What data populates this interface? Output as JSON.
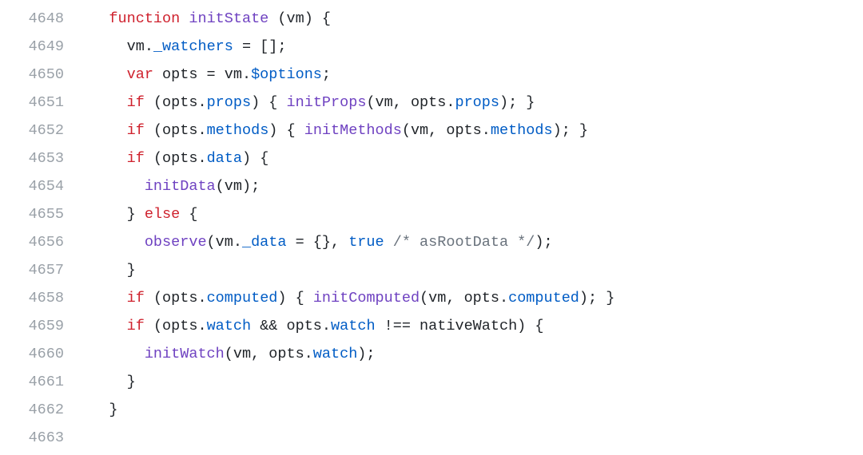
{
  "domain": "Computer-Use",
  "editor": {
    "language": "javascript",
    "first_line_number": 4648,
    "line_numbers": [
      "4648",
      "4649",
      "4650",
      "4651",
      "4652",
      "4653",
      "4654",
      "4655",
      "4656",
      "4657",
      "4658",
      "4659",
      "4660",
      "4661",
      "4662",
      "4663"
    ],
    "colors": {
      "keyword": "#cf222e",
      "function": "#6f42c1",
      "property": "#005cc5",
      "comment": "#6a737d",
      "gutter": "#9aa1a8",
      "text": "#1f2328",
      "background": "#ffffff"
    },
    "plain_source": "    function initState (vm) {\n      vm._watchers = [];\n      var opts = vm.$options;\n      if (opts.props) { initProps(vm, opts.props); }\n      if (opts.methods) { initMethods(vm, opts.methods); }\n      if (opts.data) {\n        initData(vm);\n      } else {\n        observe(vm._data = {}, true /* asRootData */);\n      }\n      if (opts.computed) { initComputed(vm, opts.computed); }\n      if (opts.watch && opts.watch !== nativeWatch) {\n        initWatch(vm, opts.watch);\n      }\n    }\n",
    "lines": [
      {
        "indent": "    ",
        "tokens": [
          {
            "t": "function",
            "c": "tk-kw"
          },
          {
            "t": " "
          },
          {
            "t": "initState",
            "c": "tk-fn"
          },
          {
            "t": " ("
          },
          {
            "t": "vm",
            "c": "tk-param"
          },
          {
            "t": ") {"
          }
        ]
      },
      {
        "indent": "      ",
        "tokens": [
          {
            "t": "vm"
          },
          {
            "t": ".",
            "c": "tk-punc"
          },
          {
            "t": "_watchers",
            "c": "tk-prop"
          },
          {
            "t": " = [];"
          }
        ]
      },
      {
        "indent": "      ",
        "tokens": [
          {
            "t": "var",
            "c": "tk-kw"
          },
          {
            "t": " opts = vm"
          },
          {
            "t": ".",
            "c": "tk-punc"
          },
          {
            "t": "$options",
            "c": "tk-prop"
          },
          {
            "t": ";"
          }
        ]
      },
      {
        "indent": "      ",
        "tokens": [
          {
            "t": "if",
            "c": "tk-kw"
          },
          {
            "t": " (opts"
          },
          {
            "t": ".",
            "c": "tk-punc"
          },
          {
            "t": "props",
            "c": "tk-prop"
          },
          {
            "t": ") { "
          },
          {
            "t": "initProps",
            "c": "tk-fn"
          },
          {
            "t": "(vm, opts"
          },
          {
            "t": ".",
            "c": "tk-punc"
          },
          {
            "t": "props",
            "c": "tk-prop"
          },
          {
            "t": "); }"
          }
        ]
      },
      {
        "indent": "      ",
        "tokens": [
          {
            "t": "if",
            "c": "tk-kw"
          },
          {
            "t": " (opts"
          },
          {
            "t": ".",
            "c": "tk-punc"
          },
          {
            "t": "methods",
            "c": "tk-prop"
          },
          {
            "t": ") { "
          },
          {
            "t": "initMethods",
            "c": "tk-fn"
          },
          {
            "t": "(vm, opts"
          },
          {
            "t": ".",
            "c": "tk-punc"
          },
          {
            "t": "methods",
            "c": "tk-prop"
          },
          {
            "t": "); }"
          }
        ]
      },
      {
        "indent": "      ",
        "tokens": [
          {
            "t": "if",
            "c": "tk-kw"
          },
          {
            "t": " (opts"
          },
          {
            "t": ".",
            "c": "tk-punc"
          },
          {
            "t": "data",
            "c": "tk-prop"
          },
          {
            "t": ") {"
          }
        ]
      },
      {
        "indent": "        ",
        "tokens": [
          {
            "t": "initData",
            "c": "tk-fn"
          },
          {
            "t": "(vm);"
          }
        ]
      },
      {
        "indent": "      ",
        "tokens": [
          {
            "t": "} "
          },
          {
            "t": "else",
            "c": "tk-kw"
          },
          {
            "t": " {"
          }
        ]
      },
      {
        "indent": "        ",
        "tokens": [
          {
            "t": "observe",
            "c": "tk-fn"
          },
          {
            "t": "(vm"
          },
          {
            "t": ".",
            "c": "tk-punc"
          },
          {
            "t": "_data",
            "c": "tk-prop"
          },
          {
            "t": " = {}, "
          },
          {
            "t": "true",
            "c": "tk-prop"
          },
          {
            "t": " "
          },
          {
            "t": "/* asRootData */",
            "c": "tk-comment"
          },
          {
            "t": ");"
          }
        ]
      },
      {
        "indent": "      ",
        "tokens": [
          {
            "t": "}"
          }
        ]
      },
      {
        "indent": "      ",
        "tokens": [
          {
            "t": "if",
            "c": "tk-kw"
          },
          {
            "t": " (opts"
          },
          {
            "t": ".",
            "c": "tk-punc"
          },
          {
            "t": "computed",
            "c": "tk-prop"
          },
          {
            "t": ") { "
          },
          {
            "t": "initComputed",
            "c": "tk-fn"
          },
          {
            "t": "(vm, opts"
          },
          {
            "t": ".",
            "c": "tk-punc"
          },
          {
            "t": "computed",
            "c": "tk-prop"
          },
          {
            "t": "); }"
          }
        ]
      },
      {
        "indent": "      ",
        "tokens": [
          {
            "t": "if",
            "c": "tk-kw"
          },
          {
            "t": " (opts"
          },
          {
            "t": ".",
            "c": "tk-punc"
          },
          {
            "t": "watch",
            "c": "tk-prop"
          },
          {
            "t": " && opts"
          },
          {
            "t": ".",
            "c": "tk-punc"
          },
          {
            "t": "watch",
            "c": "tk-prop"
          },
          {
            "t": " !== nativeWatch) {"
          }
        ]
      },
      {
        "indent": "        ",
        "tokens": [
          {
            "t": "initWatch",
            "c": "tk-fn"
          },
          {
            "t": "(vm, opts"
          },
          {
            "t": ".",
            "c": "tk-punc"
          },
          {
            "t": "watch",
            "c": "tk-prop"
          },
          {
            "t": ");"
          }
        ]
      },
      {
        "indent": "      ",
        "tokens": [
          {
            "t": "}"
          }
        ]
      },
      {
        "indent": "    ",
        "tokens": [
          {
            "t": "}"
          }
        ]
      },
      {
        "indent": "",
        "tokens": []
      }
    ]
  }
}
